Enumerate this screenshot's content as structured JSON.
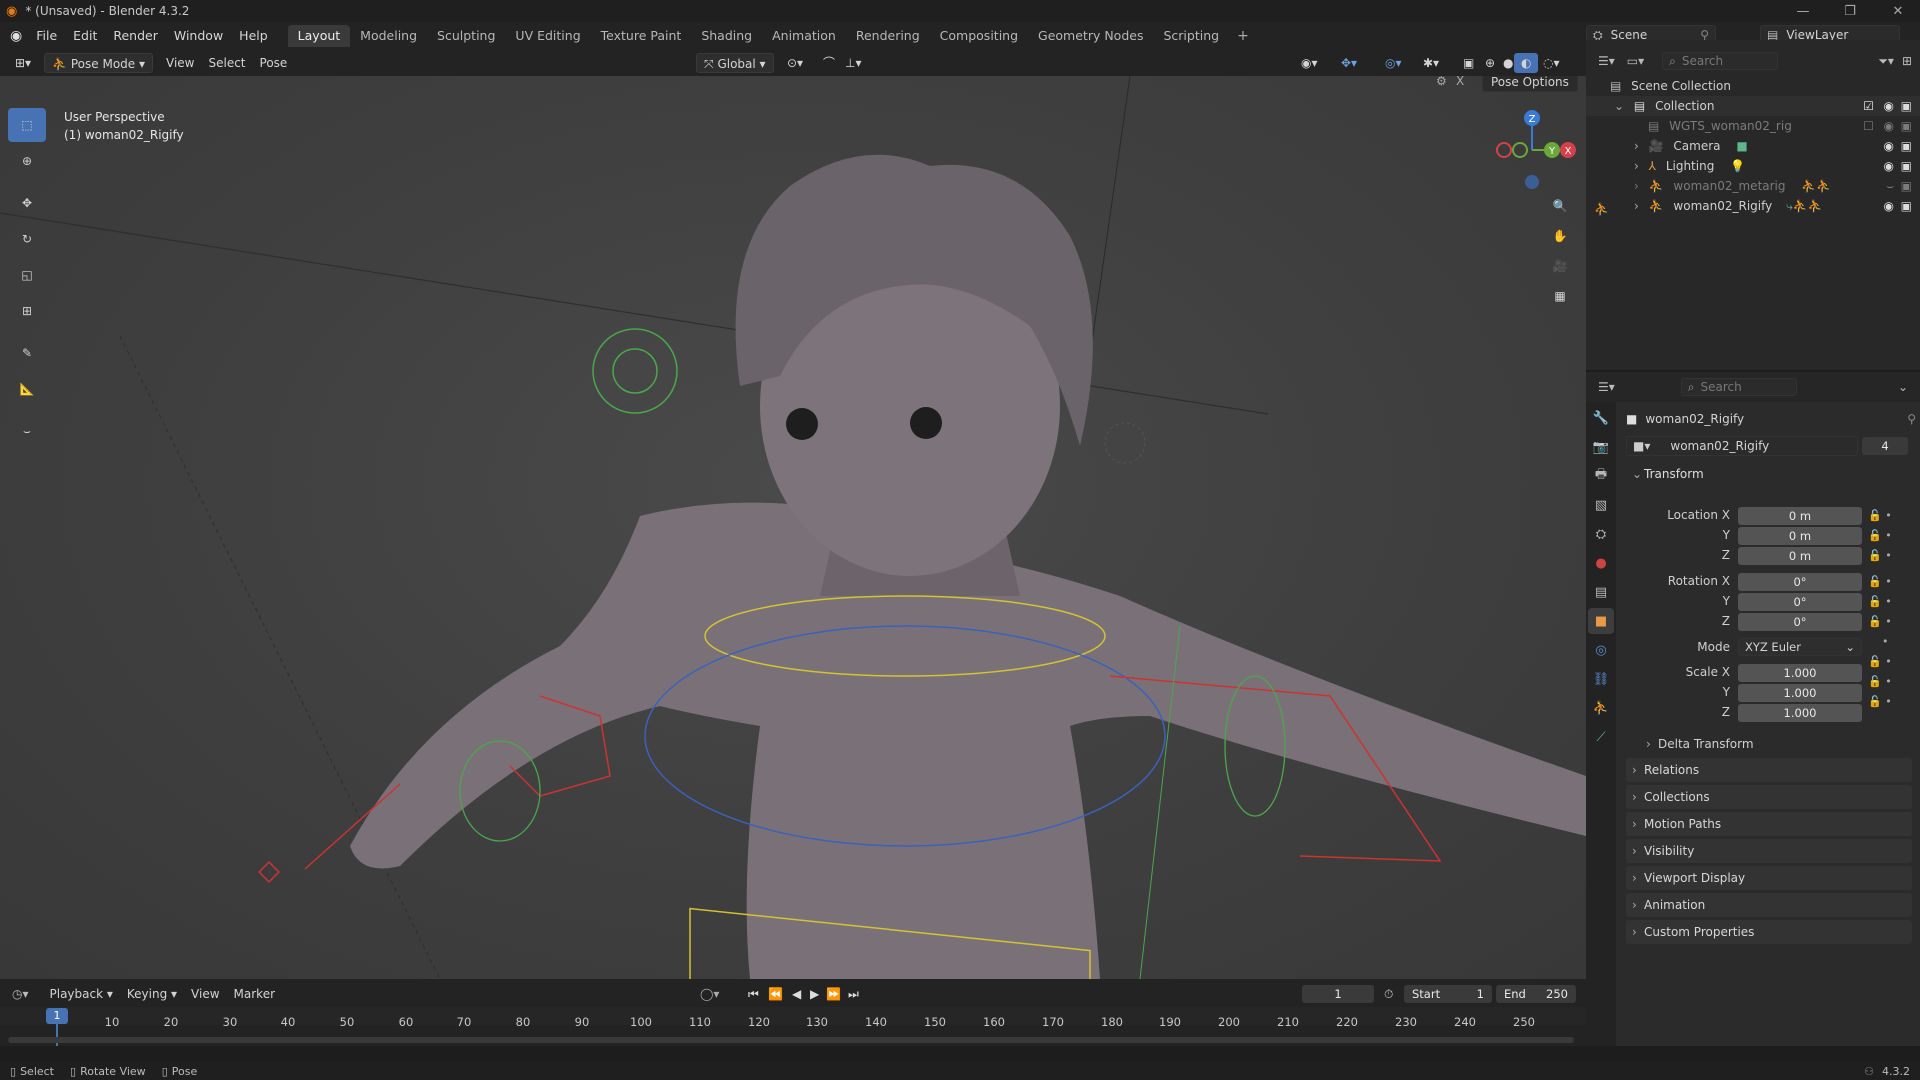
{
  "titlebar": {
    "title": "* (Unsaved) - Blender 4.3.2"
  },
  "menus": [
    "File",
    "Edit",
    "Render",
    "Window",
    "Help"
  ],
  "workspaces": [
    "Layout",
    "Modeling",
    "Sculpting",
    "UV Editing",
    "Texture Paint",
    "Shading",
    "Animation",
    "Rendering",
    "Compositing",
    "Geometry Nodes",
    "Scripting"
  ],
  "scene": {
    "label": "Scene",
    "view_layer": "ViewLayer"
  },
  "viewport": {
    "mode": "Pose Mode",
    "view": "View",
    "select": "Select",
    "pose": "Pose",
    "orientation": "Global",
    "pose_options": "Pose Options",
    "overlay_title": "User Perspective",
    "overlay_object": "(1) woman02_Rigify",
    "axis_x": "X",
    "axis_y": "Y",
    "axis_z": "Z"
  },
  "outliner": {
    "search_placeholder": "Search",
    "scene_collection": "Scene Collection",
    "items": [
      {
        "name": "Collection"
      },
      {
        "name": "WGTS_woman02_rig"
      },
      {
        "name": "Camera"
      },
      {
        "name": "Lighting"
      },
      {
        "name": "woman02_metarig"
      },
      {
        "name": "woman02_Rigify"
      }
    ]
  },
  "properties": {
    "search_placeholder": "Search",
    "object_name": "woman02_Rigify",
    "datablock_name": "woman02_Rigify",
    "users": "4",
    "transform": "Transform",
    "location_label": "Location X",
    "rotation_label": "Rotation X",
    "scale_label": "Scale X",
    "y": "Y",
    "z": "Z",
    "location": [
      "0 m",
      "0 m",
      "0 m"
    ],
    "rotation": [
      "0°",
      "0°",
      "0°"
    ],
    "mode_label": "Mode",
    "mode_value": "XYZ Euler",
    "scale": [
      "1.000",
      "1.000",
      "1.000"
    ],
    "delta": "Delta Transform",
    "sections": [
      "Relations",
      "Collections",
      "Motion Paths",
      "Visibility",
      "Viewport Display",
      "Animation",
      "Custom Properties"
    ]
  },
  "timeline": {
    "menus": [
      "Playback",
      "Keying",
      "View",
      "Marker"
    ],
    "current_frame": "1",
    "start_label": "Start",
    "start": "1",
    "end_label": "End",
    "end": "250",
    "ticks": [
      "10",
      "20",
      "30",
      "40",
      "50",
      "60",
      "70",
      "80",
      "90",
      "100",
      "110",
      "120",
      "130",
      "140",
      "150",
      "160",
      "170",
      "180",
      "190",
      "200",
      "210",
      "220",
      "230",
      "240",
      "250"
    ],
    "playhead": "1"
  },
  "status": {
    "select": "Select",
    "rotate": "Rotate View",
    "pose": "Pose",
    "version": "4.3.2"
  }
}
